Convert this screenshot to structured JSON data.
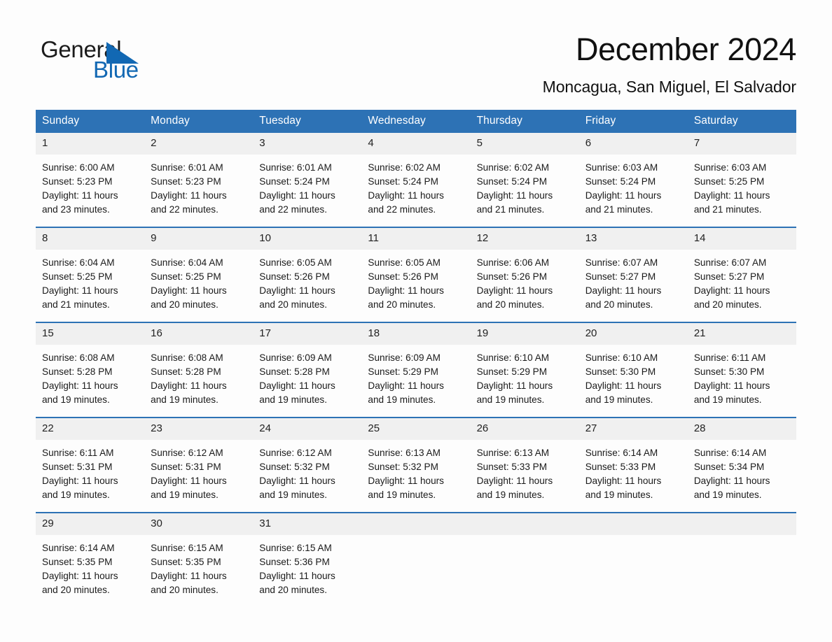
{
  "brand": {
    "name_part1": "General",
    "name_part2": "Blue",
    "flag_color": "#1268b3"
  },
  "header": {
    "month_title": "December 2024",
    "location": "Moncagua, San Miguel, El Salvador"
  },
  "theme": {
    "header_blue": "#2d72b5",
    "row_divider_blue": "#2d72b5",
    "daynum_band": "#f0f0f0",
    "page_background": "#fdfdfd"
  },
  "calendar": {
    "weekday_headers": [
      "Sunday",
      "Monday",
      "Tuesday",
      "Wednesday",
      "Thursday",
      "Friday",
      "Saturday"
    ],
    "weeks": [
      [
        {
          "day": "1",
          "sunrise": "Sunrise: 6:00 AM",
          "sunset": "Sunset: 5:23 PM",
          "daylight_line1": "Daylight: 11 hours",
          "daylight_line2": "and 23 minutes."
        },
        {
          "day": "2",
          "sunrise": "Sunrise: 6:01 AM",
          "sunset": "Sunset: 5:23 PM",
          "daylight_line1": "Daylight: 11 hours",
          "daylight_line2": "and 22 minutes."
        },
        {
          "day": "3",
          "sunrise": "Sunrise: 6:01 AM",
          "sunset": "Sunset: 5:24 PM",
          "daylight_line1": "Daylight: 11 hours",
          "daylight_line2": "and 22 minutes."
        },
        {
          "day": "4",
          "sunrise": "Sunrise: 6:02 AM",
          "sunset": "Sunset: 5:24 PM",
          "daylight_line1": "Daylight: 11 hours",
          "daylight_line2": "and 22 minutes."
        },
        {
          "day": "5",
          "sunrise": "Sunrise: 6:02 AM",
          "sunset": "Sunset: 5:24 PM",
          "daylight_line1": "Daylight: 11 hours",
          "daylight_line2": "and 21 minutes."
        },
        {
          "day": "6",
          "sunrise": "Sunrise: 6:03 AM",
          "sunset": "Sunset: 5:24 PM",
          "daylight_line1": "Daylight: 11 hours",
          "daylight_line2": "and 21 minutes."
        },
        {
          "day": "7",
          "sunrise": "Sunrise: 6:03 AM",
          "sunset": "Sunset: 5:25 PM",
          "daylight_line1": "Daylight: 11 hours",
          "daylight_line2": "and 21 minutes."
        }
      ],
      [
        {
          "day": "8",
          "sunrise": "Sunrise: 6:04 AM",
          "sunset": "Sunset: 5:25 PM",
          "daylight_line1": "Daylight: 11 hours",
          "daylight_line2": "and 21 minutes."
        },
        {
          "day": "9",
          "sunrise": "Sunrise: 6:04 AM",
          "sunset": "Sunset: 5:25 PM",
          "daylight_line1": "Daylight: 11 hours",
          "daylight_line2": "and 20 minutes."
        },
        {
          "day": "10",
          "sunrise": "Sunrise: 6:05 AM",
          "sunset": "Sunset: 5:26 PM",
          "daylight_line1": "Daylight: 11 hours",
          "daylight_line2": "and 20 minutes."
        },
        {
          "day": "11",
          "sunrise": "Sunrise: 6:05 AM",
          "sunset": "Sunset: 5:26 PM",
          "daylight_line1": "Daylight: 11 hours",
          "daylight_line2": "and 20 minutes."
        },
        {
          "day": "12",
          "sunrise": "Sunrise: 6:06 AM",
          "sunset": "Sunset: 5:26 PM",
          "daylight_line1": "Daylight: 11 hours",
          "daylight_line2": "and 20 minutes."
        },
        {
          "day": "13",
          "sunrise": "Sunrise: 6:07 AM",
          "sunset": "Sunset: 5:27 PM",
          "daylight_line1": "Daylight: 11 hours",
          "daylight_line2": "and 20 minutes."
        },
        {
          "day": "14",
          "sunrise": "Sunrise: 6:07 AM",
          "sunset": "Sunset: 5:27 PM",
          "daylight_line1": "Daylight: 11 hours",
          "daylight_line2": "and 20 minutes."
        }
      ],
      [
        {
          "day": "15",
          "sunrise": "Sunrise: 6:08 AM",
          "sunset": "Sunset: 5:28 PM",
          "daylight_line1": "Daylight: 11 hours",
          "daylight_line2": "and 19 minutes."
        },
        {
          "day": "16",
          "sunrise": "Sunrise: 6:08 AM",
          "sunset": "Sunset: 5:28 PM",
          "daylight_line1": "Daylight: 11 hours",
          "daylight_line2": "and 19 minutes."
        },
        {
          "day": "17",
          "sunrise": "Sunrise: 6:09 AM",
          "sunset": "Sunset: 5:28 PM",
          "daylight_line1": "Daylight: 11 hours",
          "daylight_line2": "and 19 minutes."
        },
        {
          "day": "18",
          "sunrise": "Sunrise: 6:09 AM",
          "sunset": "Sunset: 5:29 PM",
          "daylight_line1": "Daylight: 11 hours",
          "daylight_line2": "and 19 minutes."
        },
        {
          "day": "19",
          "sunrise": "Sunrise: 6:10 AM",
          "sunset": "Sunset: 5:29 PM",
          "daylight_line1": "Daylight: 11 hours",
          "daylight_line2": "and 19 minutes."
        },
        {
          "day": "20",
          "sunrise": "Sunrise: 6:10 AM",
          "sunset": "Sunset: 5:30 PM",
          "daylight_line1": "Daylight: 11 hours",
          "daylight_line2": "and 19 minutes."
        },
        {
          "day": "21",
          "sunrise": "Sunrise: 6:11 AM",
          "sunset": "Sunset: 5:30 PM",
          "daylight_line1": "Daylight: 11 hours",
          "daylight_line2": "and 19 minutes."
        }
      ],
      [
        {
          "day": "22",
          "sunrise": "Sunrise: 6:11 AM",
          "sunset": "Sunset: 5:31 PM",
          "daylight_line1": "Daylight: 11 hours",
          "daylight_line2": "and 19 minutes."
        },
        {
          "day": "23",
          "sunrise": "Sunrise: 6:12 AM",
          "sunset": "Sunset: 5:31 PM",
          "daylight_line1": "Daylight: 11 hours",
          "daylight_line2": "and 19 minutes."
        },
        {
          "day": "24",
          "sunrise": "Sunrise: 6:12 AM",
          "sunset": "Sunset: 5:32 PM",
          "daylight_line1": "Daylight: 11 hours",
          "daylight_line2": "and 19 minutes."
        },
        {
          "day": "25",
          "sunrise": "Sunrise: 6:13 AM",
          "sunset": "Sunset: 5:32 PM",
          "daylight_line1": "Daylight: 11 hours",
          "daylight_line2": "and 19 minutes."
        },
        {
          "day": "26",
          "sunrise": "Sunrise: 6:13 AM",
          "sunset": "Sunset: 5:33 PM",
          "daylight_line1": "Daylight: 11 hours",
          "daylight_line2": "and 19 minutes."
        },
        {
          "day": "27",
          "sunrise": "Sunrise: 6:14 AM",
          "sunset": "Sunset: 5:33 PM",
          "daylight_line1": "Daylight: 11 hours",
          "daylight_line2": "and 19 minutes."
        },
        {
          "day": "28",
          "sunrise": "Sunrise: 6:14 AM",
          "sunset": "Sunset: 5:34 PM",
          "daylight_line1": "Daylight: 11 hours",
          "daylight_line2": "and 19 minutes."
        }
      ],
      [
        {
          "day": "29",
          "sunrise": "Sunrise: 6:14 AM",
          "sunset": "Sunset: 5:35 PM",
          "daylight_line1": "Daylight: 11 hours",
          "daylight_line2": "and 20 minutes."
        },
        {
          "day": "30",
          "sunrise": "Sunrise: 6:15 AM",
          "sunset": "Sunset: 5:35 PM",
          "daylight_line1": "Daylight: 11 hours",
          "daylight_line2": "and 20 minutes."
        },
        {
          "day": "31",
          "sunrise": "Sunrise: 6:15 AM",
          "sunset": "Sunset: 5:36 PM",
          "daylight_line1": "Daylight: 11 hours",
          "daylight_line2": "and 20 minutes."
        },
        {
          "day": "",
          "sunrise": "",
          "sunset": "",
          "daylight_line1": "",
          "daylight_line2": ""
        },
        {
          "day": "",
          "sunrise": "",
          "sunset": "",
          "daylight_line1": "",
          "daylight_line2": ""
        },
        {
          "day": "",
          "sunrise": "",
          "sunset": "",
          "daylight_line1": "",
          "daylight_line2": ""
        },
        {
          "day": "",
          "sunrise": "",
          "sunset": "",
          "daylight_line1": "",
          "daylight_line2": ""
        }
      ]
    ]
  }
}
